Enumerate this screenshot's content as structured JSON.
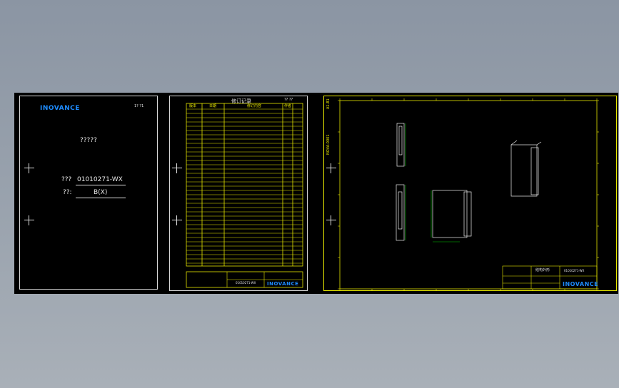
{
  "cover": {
    "logo": "INOVANCE",
    "corner": "1? ?1",
    "title": "?????",
    "code_label": "???",
    "code_value": "01010271-WX",
    "rev_label": "??:",
    "rev_value": "B(X)"
  },
  "record": {
    "title": "修订记录",
    "corner": "?? ??",
    "header_cells": [
      "版本",
      "日期",
      "修订内容",
      "作者"
    ],
    "doc_no": "01010271-WX",
    "logo": "INOVANCE"
  },
  "drawing": {
    "logo": "INOVANCE",
    "left_margin_text": "A1.B1",
    "left_margin_text2": "NOVA-0001",
    "title_block_name": "结构外形",
    "title_block_code": "01010271-WX"
  },
  "colors": {
    "background": "#000000",
    "frame": "#d8d8d8",
    "drawing_lines": "#e6e600",
    "logo": "#1e8cff",
    "dimension": "#00c800"
  }
}
